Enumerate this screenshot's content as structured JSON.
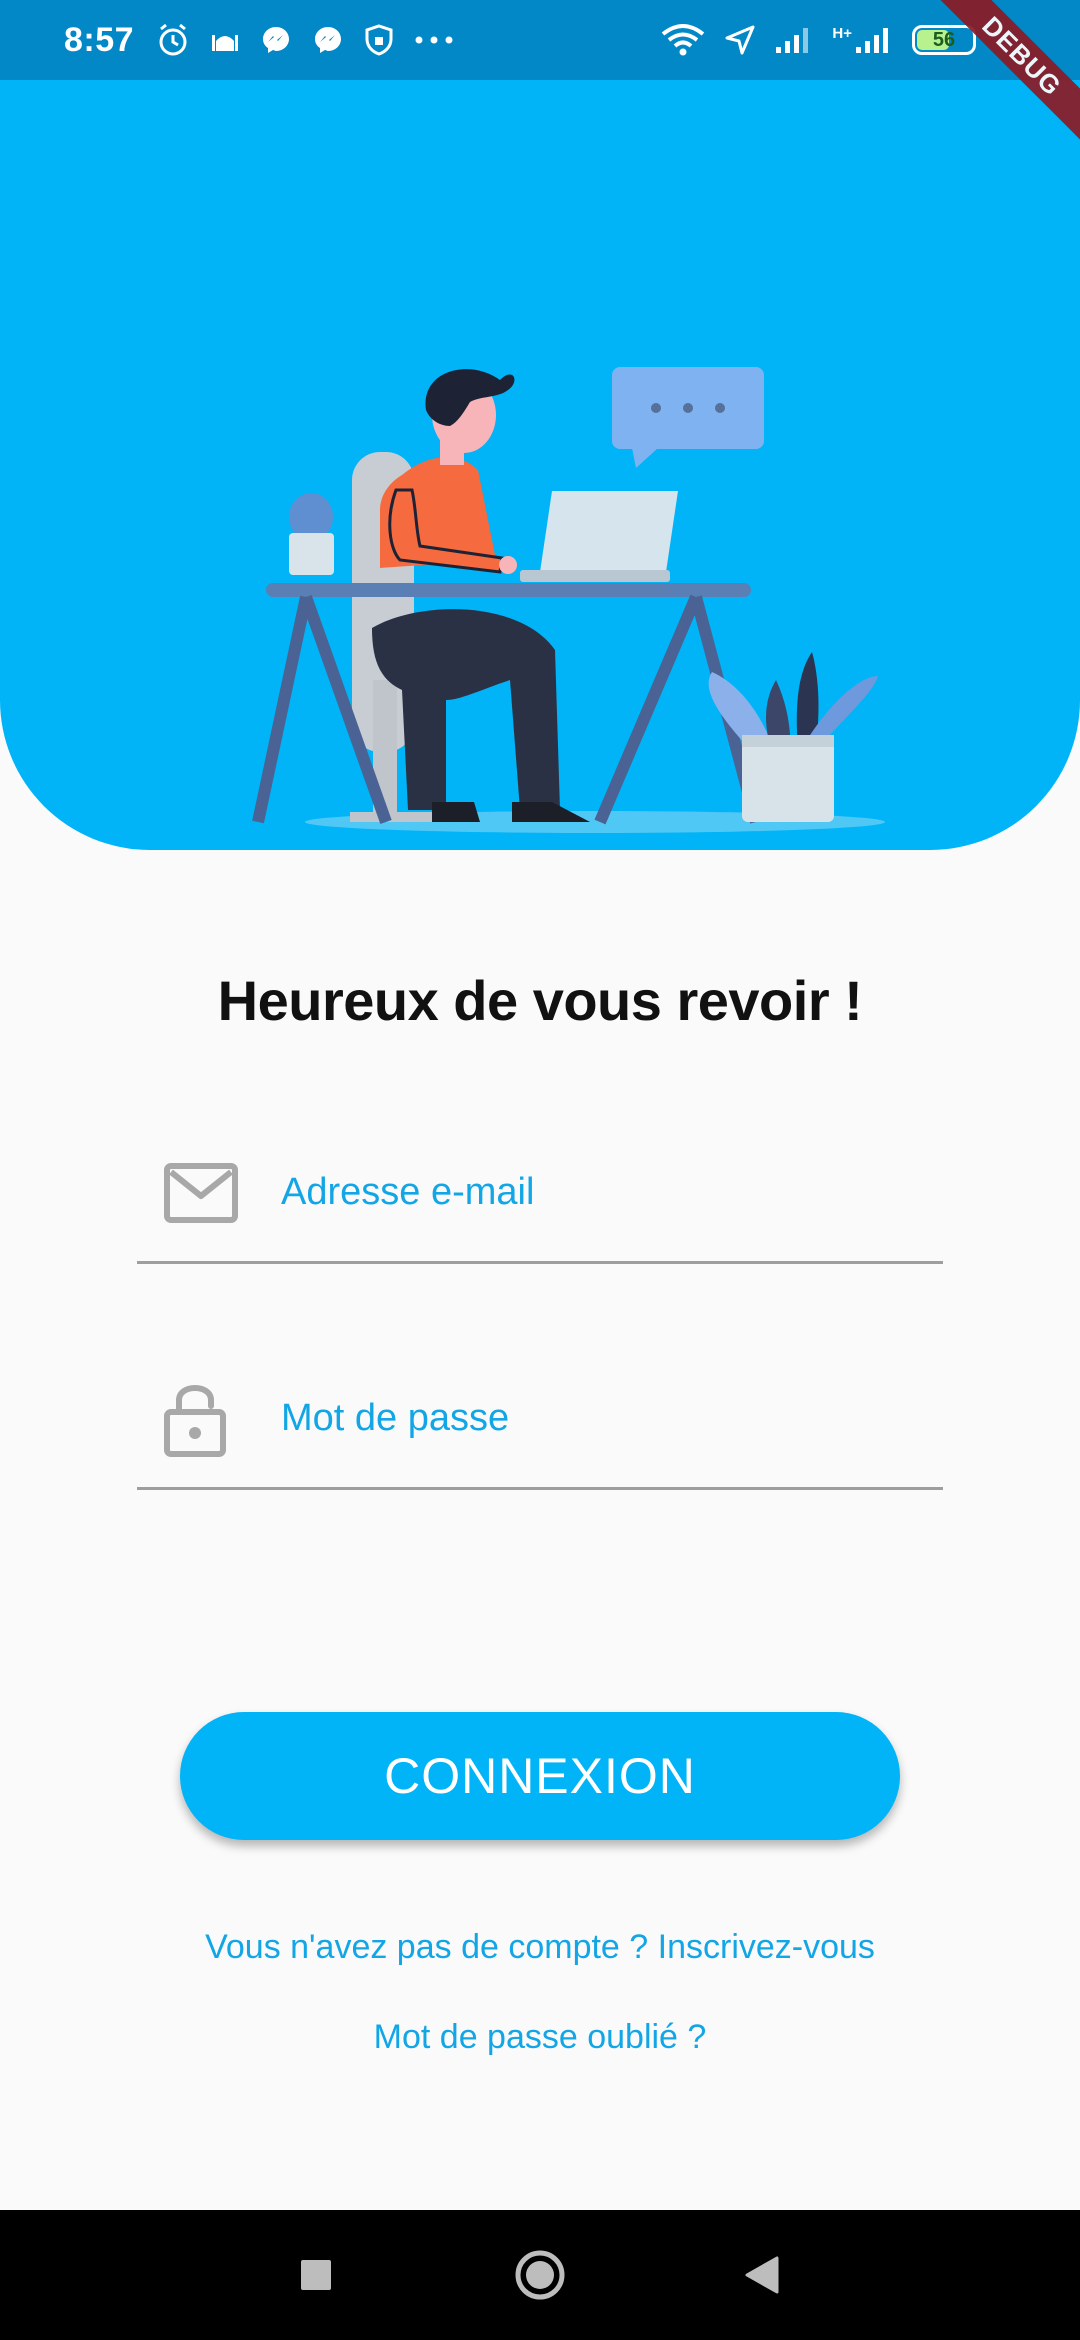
{
  "status_bar": {
    "time": "8:57",
    "network_type": "H+",
    "battery_level": "56",
    "left_icons": [
      "alarm-icon",
      "mosque-icon",
      "messenger-icon",
      "messenger-icon",
      "shield-icon",
      "more-dots-icon"
    ],
    "right_icons": [
      "wifi-icon",
      "location-arrow-icon",
      "signal-icon",
      "signal-icon",
      "battery-icon"
    ]
  },
  "debug_banner": "DEBUG",
  "hero": {
    "illustration": "person-working-at-laptop-illustration",
    "colors": {
      "background": "#00b4f7"
    }
  },
  "login": {
    "title": "Heureux de vous revoir !",
    "email": {
      "placeholder": "Adresse e-mail",
      "value": "",
      "icon": "mail-icon"
    },
    "password": {
      "placeholder": "Mot de passe",
      "value": "",
      "icon": "lock-icon"
    },
    "submit_label": "CONNEXION",
    "signup_link": "Vous n'avez pas de compte ? Inscrivez-vous",
    "forgot_link": "Mot de passe oublié ?"
  },
  "nav_bar": {
    "buttons": [
      "recents-square-icon",
      "home-circle-icon",
      "back-triangle-icon"
    ]
  },
  "colors": {
    "accent": "#00b4f7",
    "status_bar": "#0288c6",
    "link": "#13a6e6",
    "underline": "#9e9e9e"
  }
}
